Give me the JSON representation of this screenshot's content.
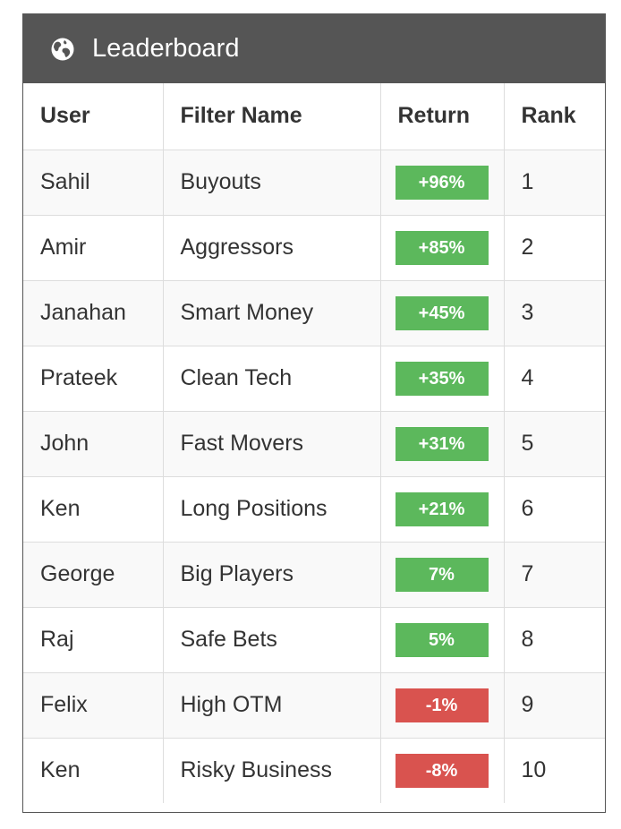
{
  "header": {
    "title": "Leaderboard",
    "icon": "globe-icon"
  },
  "colors": {
    "header_bg": "#555555",
    "positive": "#5cb85c",
    "negative": "#d9534f",
    "stripe": "#f9f9f9"
  },
  "table": {
    "columns": [
      "User",
      "Filter Name",
      "Return",
      "Rank"
    ],
    "rows": [
      {
        "user": "Sahil",
        "filter": "Buyouts",
        "return": "+96%",
        "trend": "positive",
        "rank": "1"
      },
      {
        "user": "Amir",
        "filter": "Aggressors",
        "return": "+85%",
        "trend": "positive",
        "rank": "2"
      },
      {
        "user": "Janahan",
        "filter": "Smart Money",
        "return": "+45%",
        "trend": "positive",
        "rank": "3"
      },
      {
        "user": "Prateek",
        "filter": "Clean Tech",
        "return": "+35%",
        "trend": "positive",
        "rank": "4"
      },
      {
        "user": "John",
        "filter": "Fast Movers",
        "return": "+31%",
        "trend": "positive",
        "rank": "5"
      },
      {
        "user": "Ken",
        "filter": "Long Positions",
        "return": "+21%",
        "trend": "positive",
        "rank": "6"
      },
      {
        "user": "George",
        "filter": "Big Players",
        "return": "7%",
        "trend": "positive",
        "rank": "7"
      },
      {
        "user": "Raj",
        "filter": "Safe Bets",
        "return": "5%",
        "trend": "positive",
        "rank": "8"
      },
      {
        "user": "Felix",
        "filter": "High OTM",
        "return": "-1%",
        "trend": "negative",
        "rank": "9"
      },
      {
        "user": "Ken",
        "filter": "Risky Business",
        "return": "-8%",
        "trend": "negative",
        "rank": "10"
      }
    ]
  }
}
